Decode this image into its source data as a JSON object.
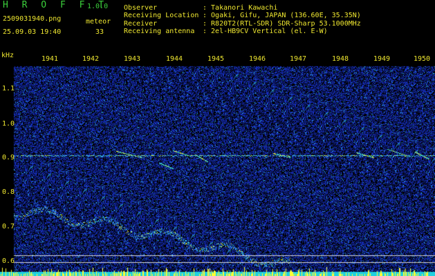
{
  "app": {
    "title": "H R O F F T",
    "version": "1.0.0"
  },
  "file": {
    "name": "2509031940.png",
    "datetime": "25.09.03 19:40"
  },
  "meteor": {
    "label": "meteor",
    "count": "33"
  },
  "info": {
    "rows": [
      {
        "key": "Observer",
        "value": ": Takanori Kawachi"
      },
      {
        "key": "Receiving Location",
        "value": ": Ogaki, Gifu, JAPAN (136.60E, 35.35N)"
      },
      {
        "key": "Receiver",
        "value": ": R820T2(RTL-SDR) SDR-Sharp 53.1000MHz"
      },
      {
        "key": "Receiving antenna",
        "value": ": 2el-HB9CV Vertical (el. E-W)"
      }
    ]
  },
  "axes": {
    "y_unit": "kHz",
    "y_ticks": [
      "1.1",
      "1.0",
      "0.9",
      "0.8",
      "0.7",
      "0.6"
    ],
    "x_ticks": [
      "1941",
      "1942",
      "1943",
      "1944",
      "1945",
      "1946",
      "1947",
      "1948",
      "1949",
      "1950"
    ]
  },
  "colors": {
    "background": "#000000",
    "text": "#f0e830",
    "title": "#3cd23c",
    "signal_strong": "#ffff30",
    "noise": "#1a2fd0",
    "baseline": "#20d0e0"
  }
}
